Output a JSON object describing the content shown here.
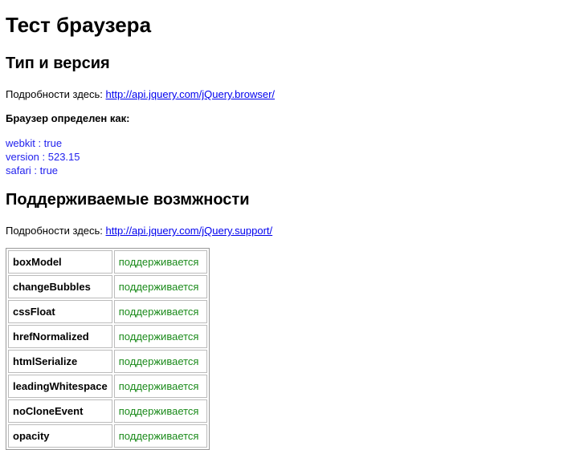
{
  "title": "Тест браузера",
  "section1": {
    "heading": "Тип и версия",
    "details_label": "Подробности здесь:",
    "details_link": "http://api.jquery.com/jQuery.browser/",
    "detected_label": "Браузер определен как:",
    "values": [
      "webkit : true",
      "version : 523.15",
      "safari : true"
    ]
  },
  "section2": {
    "heading": "Поддерживаемые возмжности",
    "details_label": "Подробности здесь:",
    "details_link": "http://api.jquery.com/jQuery.support/",
    "features": [
      {
        "name": "boxModel",
        "status": "поддерживается"
      },
      {
        "name": "changeBubbles",
        "status": "поддерживается"
      },
      {
        "name": "cssFloat",
        "status": "поддерживается"
      },
      {
        "name": "hrefNormalized",
        "status": "поддерживается"
      },
      {
        "name": "htmlSerialize",
        "status": "поддерживается"
      },
      {
        "name": "leadingWhitespace",
        "status": "поддерживается"
      },
      {
        "name": "noCloneEvent",
        "status": "поддерживается"
      },
      {
        "name": "opacity",
        "status": "поддерживается"
      }
    ]
  }
}
